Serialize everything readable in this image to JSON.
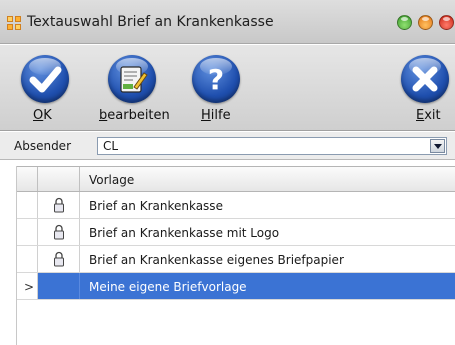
{
  "window": {
    "title": "Textauswahl Brief an Krankenkasse",
    "icon": "app-grid-icon",
    "controls": [
      "green-button",
      "orange-button",
      "red-button"
    ]
  },
  "toolbar": {
    "buttons": [
      {
        "label": "OK",
        "hotkey": "O",
        "rest": "K",
        "icon": "check-icon"
      },
      {
        "label": "bearbeiten",
        "hotkey": "b",
        "rest": "earbeiten",
        "icon": "edit-document-icon"
      },
      {
        "label": "Hilfe",
        "hotkey": "H",
        "rest": "ilfe",
        "icon": "help-icon"
      },
      {
        "label": "Exit",
        "hotkey": "E",
        "rest": "xit",
        "icon": "close-icon"
      }
    ]
  },
  "sender": {
    "label": "Absender",
    "value": "CL"
  },
  "grid": {
    "column_header": "Vorlage",
    "rows": [
      {
        "text": "Brief an Krankenkasse",
        "has_lock": true,
        "selected": false
      },
      {
        "text": "Brief an Krankenkasse mit Logo",
        "has_lock": true,
        "selected": false
      },
      {
        "text": "Brief an Krankenkasse eigenes Briefpapier",
        "has_lock": true,
        "selected": false
      },
      {
        "text": "Meine eigene Briefvorlage",
        "has_lock": false,
        "selected": true
      }
    ],
    "current_row_indicator": ">"
  },
  "colors": {
    "selection": "#3b73d4",
    "button_blue": "#1f4fae"
  }
}
